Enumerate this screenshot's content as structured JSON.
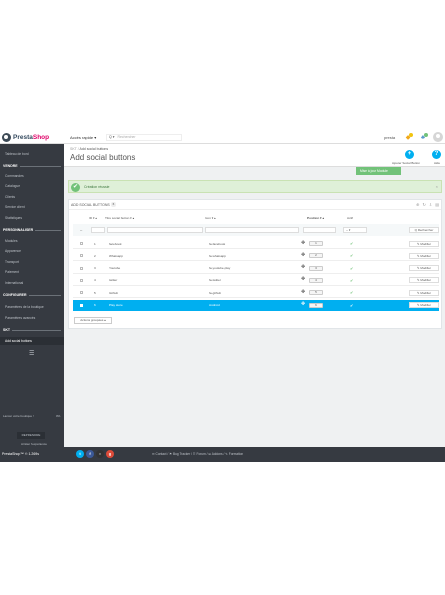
{
  "header": {
    "logo_text": "Presta",
    "logo_accent": "Shop",
    "quick_access": "Accès rapide ▾",
    "search_placeholder": "Rechercher",
    "search_prefix": "Q ▾",
    "shop_name": "presta"
  },
  "sidebar": {
    "dashboard": "Tableau de bord",
    "sections": [
      {
        "title": "VENDRE",
        "items": [
          "Commandes",
          "Catalogue",
          "Clients",
          "Service client",
          "Statistiques"
        ]
      },
      {
        "title": "PERSONNALISER",
        "items": [
          "Modules",
          "Apparence",
          "Transport",
          "Paiement",
          "International"
        ]
      },
      {
        "title": "CONFIGURER",
        "items": [
          "Paramètres de la boutique",
          "Paramètres avancés"
        ]
      },
      {
        "title": "SKT",
        "items": [
          "Add social buttons"
        ]
      }
    ],
    "footer_text": "Lancer votre boutique !",
    "footer_pct": "0%",
    "footer_button": "REPRENDRE",
    "footer_link": "Arrêter l'expérience"
  },
  "page": {
    "breadcrumb_root": "SKT",
    "breadcrumb_sep": "/",
    "breadcrumb_current": "Add social buttons",
    "title": "Add social buttons",
    "add_label": "Ajouter Social Button",
    "help_label": "Aide",
    "update_button": "Mise à jour Module"
  },
  "alert": {
    "text": "Création réussie"
  },
  "panel": {
    "title": "ADD SOCIAL BUTTONS",
    "count": "6",
    "columns": {
      "id": "ID ▾ ▴",
      "name": "Titre social button ▾ ▴",
      "icon": "Icon ▾ ▴",
      "position": "Position ▾ ▴",
      "active": "Actif"
    },
    "filter_select": "-- ▾",
    "search_button": "Q Rechercher",
    "edit_label": "✎ Modifier",
    "rows": [
      {
        "id": "1",
        "name": "facebook",
        "icon": "fa-facebook",
        "position": "1",
        "active": "✔"
      },
      {
        "id": "2",
        "name": "Whatsapp",
        "icon": "fa-whatsapp",
        "position": "2",
        "active": "✔"
      },
      {
        "id": "3",
        "name": "Youtube",
        "icon": "fa-youtube-play",
        "position": "3",
        "active": "✔"
      },
      {
        "id": "4",
        "name": "twitter",
        "icon": "fa-twitter",
        "position": "4",
        "active": "✔"
      },
      {
        "id": "5",
        "name": "Github",
        "icon": "fa-github",
        "position": "5",
        "active": "✔"
      },
      {
        "id": "6",
        "name": "Play store",
        "icon": "Android",
        "position": "6",
        "active": "✔"
      }
    ],
    "bulk_actions": "Actions groupées ▴"
  },
  "footer": {
    "brand": "PrestaShop™ ⏲ 1.269s",
    "links": "✉ Contact / ⚑ Bug Tracker / ☰ Forum / ⊞ Addons / ✎ Formation"
  },
  "colors": {
    "sidebar": "#363a41",
    "accent": "#00aff0",
    "success": "#72c279",
    "brand_pink": "#df0067"
  }
}
